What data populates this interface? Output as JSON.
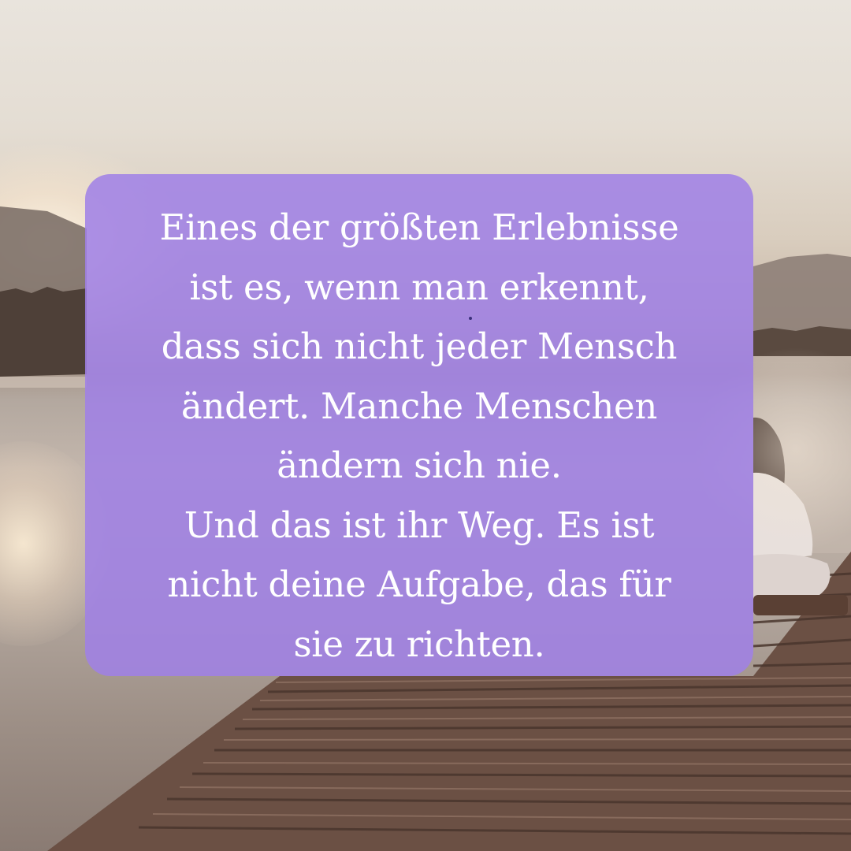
{
  "quote": {
    "lines": [
      "Eines der größten Erlebnisse",
      "ist es, wenn man erkennt,",
      "dass sich nicht jeder Mensch",
      "ändert. Manche Menschen",
      "ändern sich nie.",
      "Und das ist ihr Weg. Es ist",
      "nicht deine Aufgabe, das für",
      "sie zu richten."
    ]
  },
  "colors": {
    "card": "#a080e6",
    "text": "#ffffff",
    "sky": "#e9e4dd",
    "dock": "#6e5448"
  }
}
